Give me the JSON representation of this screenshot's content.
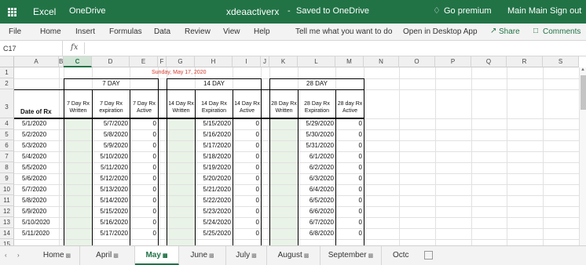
{
  "topbar": {
    "app_name": "Excel",
    "location": "OneDrive",
    "file_name": "xdeaactiverx",
    "separator": "-",
    "save_status": "Saved to OneDrive",
    "premium": "Go premium",
    "user": "Main Main",
    "sign_out": "Sign out"
  },
  "ribbon": {
    "menus": [
      "File",
      "Home",
      "Insert",
      "Formulas",
      "Data",
      "Review",
      "View",
      "Help",
      "Tell me what you want to do",
      "Open in Desktop App"
    ],
    "share": "Share",
    "comments": "Comments"
  },
  "formula_bar": {
    "name_box": "C17",
    "fx": "fx",
    "value": ""
  },
  "columns": [
    "A",
    "B",
    "C",
    "D",
    "E",
    "F",
    "G",
    "H",
    "I",
    "J",
    "K",
    "L",
    "M",
    "N",
    "O",
    "P",
    "Q",
    "R",
    "S"
  ],
  "selected_column": "C",
  "rows": [
    "1",
    "2",
    "3",
    "4",
    "5",
    "6",
    "7",
    "8",
    "9",
    "10",
    "11",
    "12",
    "13",
    "14",
    "15"
  ],
  "sheet": {
    "date_banner": "Sunday, May 17, 2020",
    "group_7": "7 DAY",
    "group_14": "14 DAY",
    "group_28": "28 DAY",
    "headers": {
      "date_of_rx": "Date of Rx",
      "d7_written": "7 Day Rx Written",
      "d7_expiration": "7 Day Rx expiration",
      "d7_active": "7 Day Rx Active",
      "d14_written": "14 Day Rx Written",
      "d14_expiration": "14 Day Rx Expiration",
      "d14_active": "14 Day Rx Active",
      "d28_written": "28 Day Rx Written",
      "d28_expiration": "28 Day Rx Expiration",
      "d28_active": "28 day Rx Active"
    },
    "data_rows": [
      {
        "date": "5/1/2020",
        "exp7": "5/7/2020",
        "act7": "0",
        "exp14": "5/15/2020",
        "act14": "0",
        "exp28": "5/29/2020",
        "act28": "0"
      },
      {
        "date": "5/2/2020",
        "exp7": "5/8/2020",
        "act7": "0",
        "exp14": "5/16/2020",
        "act14": "0",
        "exp28": "5/30/2020",
        "act28": "0"
      },
      {
        "date": "5/3/2020",
        "exp7": "5/9/2020",
        "act7": "0",
        "exp14": "5/17/2020",
        "act14": "0",
        "exp28": "5/31/2020",
        "act28": "0"
      },
      {
        "date": "5/4/2020",
        "exp7": "5/10/2020",
        "act7": "0",
        "exp14": "5/18/2020",
        "act14": "0",
        "exp28": "6/1/2020",
        "act28": "0"
      },
      {
        "date": "5/5/2020",
        "exp7": "5/11/2020",
        "act7": "0",
        "exp14": "5/19/2020",
        "act14": "0",
        "exp28": "6/2/2020",
        "act28": "0"
      },
      {
        "date": "5/6/2020",
        "exp7": "5/12/2020",
        "act7": "0",
        "exp14": "5/20/2020",
        "act14": "0",
        "exp28": "6/3/2020",
        "act28": "0"
      },
      {
        "date": "5/7/2020",
        "exp7": "5/13/2020",
        "act7": "0",
        "exp14": "5/21/2020",
        "act14": "0",
        "exp28": "6/4/2020",
        "act28": "0"
      },
      {
        "date": "5/8/2020",
        "exp7": "5/14/2020",
        "act7": "0",
        "exp14": "5/22/2020",
        "act14": "0",
        "exp28": "6/5/2020",
        "act28": "0"
      },
      {
        "date": "5/9/2020",
        "exp7": "5/15/2020",
        "act7": "0",
        "exp14": "5/23/2020",
        "act14": "0",
        "exp28": "6/6/2020",
        "act28": "0"
      },
      {
        "date": "5/10/2020",
        "exp7": "5/16/2020",
        "act7": "0",
        "exp14": "5/24/2020",
        "act14": "0",
        "exp28": "6/7/2020",
        "act28": "0"
      },
      {
        "date": "5/11/2020",
        "exp7": "5/17/2020",
        "act7": "0",
        "exp14": "5/25/2020",
        "act14": "0",
        "exp28": "6/8/2020",
        "act28": "0"
      }
    ]
  },
  "tabs": [
    "Home",
    "April",
    "May",
    "June",
    "July",
    "August",
    "September",
    "Octc"
  ],
  "active_tab": "May",
  "icons": {
    "waffle": "app-launcher-icon",
    "premium": "diamond-icon",
    "share": "share-icon",
    "comments": "comment-icon",
    "lock": "lock-icon"
  },
  "colors": {
    "brand": "#217346",
    "shade": "#e9f3e7",
    "banner_text": "#d23a2c"
  }
}
